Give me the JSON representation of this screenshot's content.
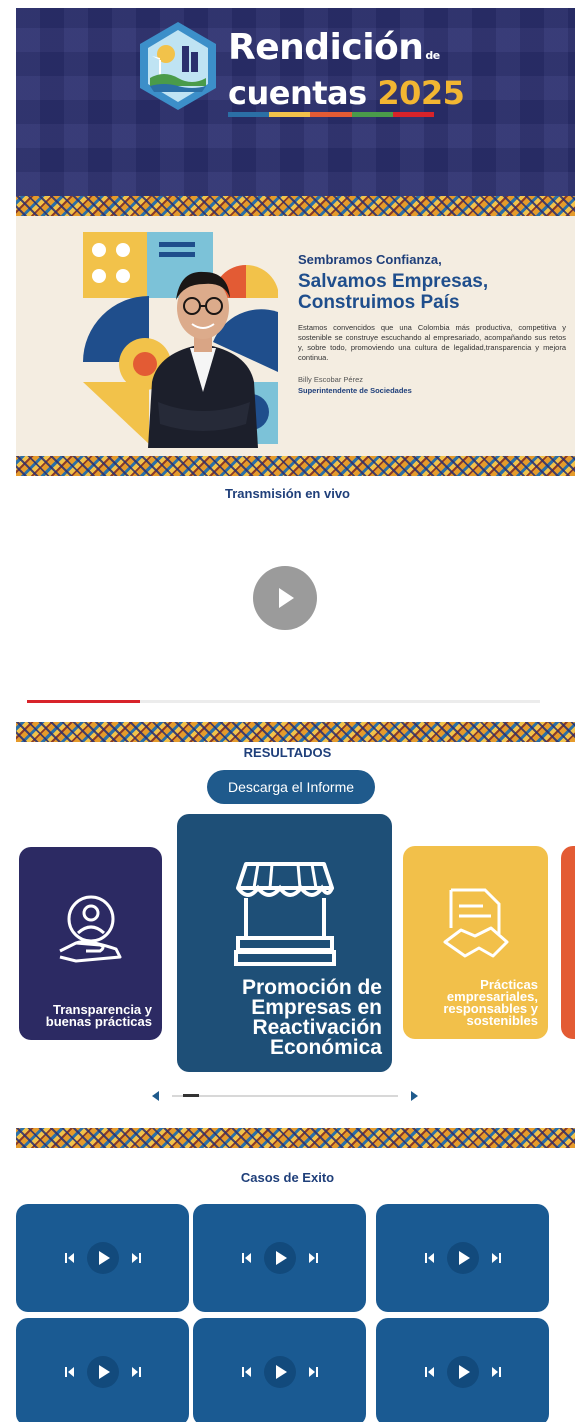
{
  "header": {
    "logo_line1": "Rendición",
    "logo_de": "de",
    "logo_line2": "cuentas",
    "logo_year": "2025",
    "accent_colors": [
      "#2b6fa6",
      "#f2c24a",
      "#e35b34",
      "#4a9b4a",
      "#d8232a"
    ]
  },
  "banner": {
    "headline_small": "Sembramos Confianza,",
    "headline_big_1": "Salvamos Empresas,",
    "headline_big_2": "Construimos País",
    "body": "Estamos convencidos que una Colombia más productiva, competitiva y sostenible se construye escuchando al empresariado, acompañando sus retos y, sobre todo, promoviendo una cultura de legalidad,transparencia y mejora continua.",
    "signature_name": "Billy Escobar Pérez",
    "signature_role": "Superintendente de Sociedades"
  },
  "live": {
    "title": "Transmisión en vivo",
    "progress": 0.22
  },
  "results": {
    "title": "RESULTADOS",
    "download_label": "Descarga el Informe",
    "cards": [
      {
        "label": "Transparencia y buenas prácticas",
        "icon": "hand-person-icon",
        "color": "#2c2a63"
      },
      {
        "label": "Promoción de Empresas en Reactivación Económica",
        "icon": "storefront-icon",
        "color": "#1e4f77"
      },
      {
        "label": "Prácticas empresariales, responsables y sostenibles",
        "icon": "handshake-document-icon",
        "color": "#f2c04a"
      }
    ],
    "slider_position": 0.05
  },
  "cases": {
    "title": "Casos de Exito",
    "video_count": 6
  }
}
